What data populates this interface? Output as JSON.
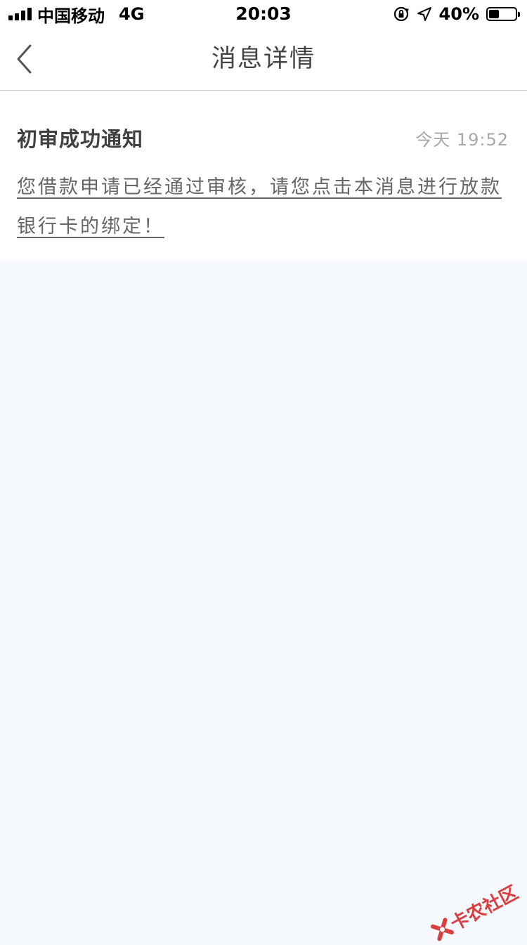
{
  "status_bar": {
    "carrier": "中国移动",
    "network": "4G",
    "time": "20:03",
    "battery": "40%",
    "battery_level": 0.4,
    "icons": [
      "signal-icon",
      "orientation-lock-icon",
      "location-arrow-icon",
      "battery-icon"
    ]
  },
  "nav": {
    "back_icon": "chevron-left-icon",
    "title": "消息详情"
  },
  "message": {
    "title": "初审成功通知",
    "time": "今天  19:52",
    "body": "您借款申请已经通过审核，请您点击本消息进行放款银行卡的绑定！"
  },
  "watermark": {
    "text": "卡农社区"
  },
  "colors": {
    "background": "#f5f8fc",
    "card": "#ffffff",
    "watermark": "#d82a2a"
  }
}
